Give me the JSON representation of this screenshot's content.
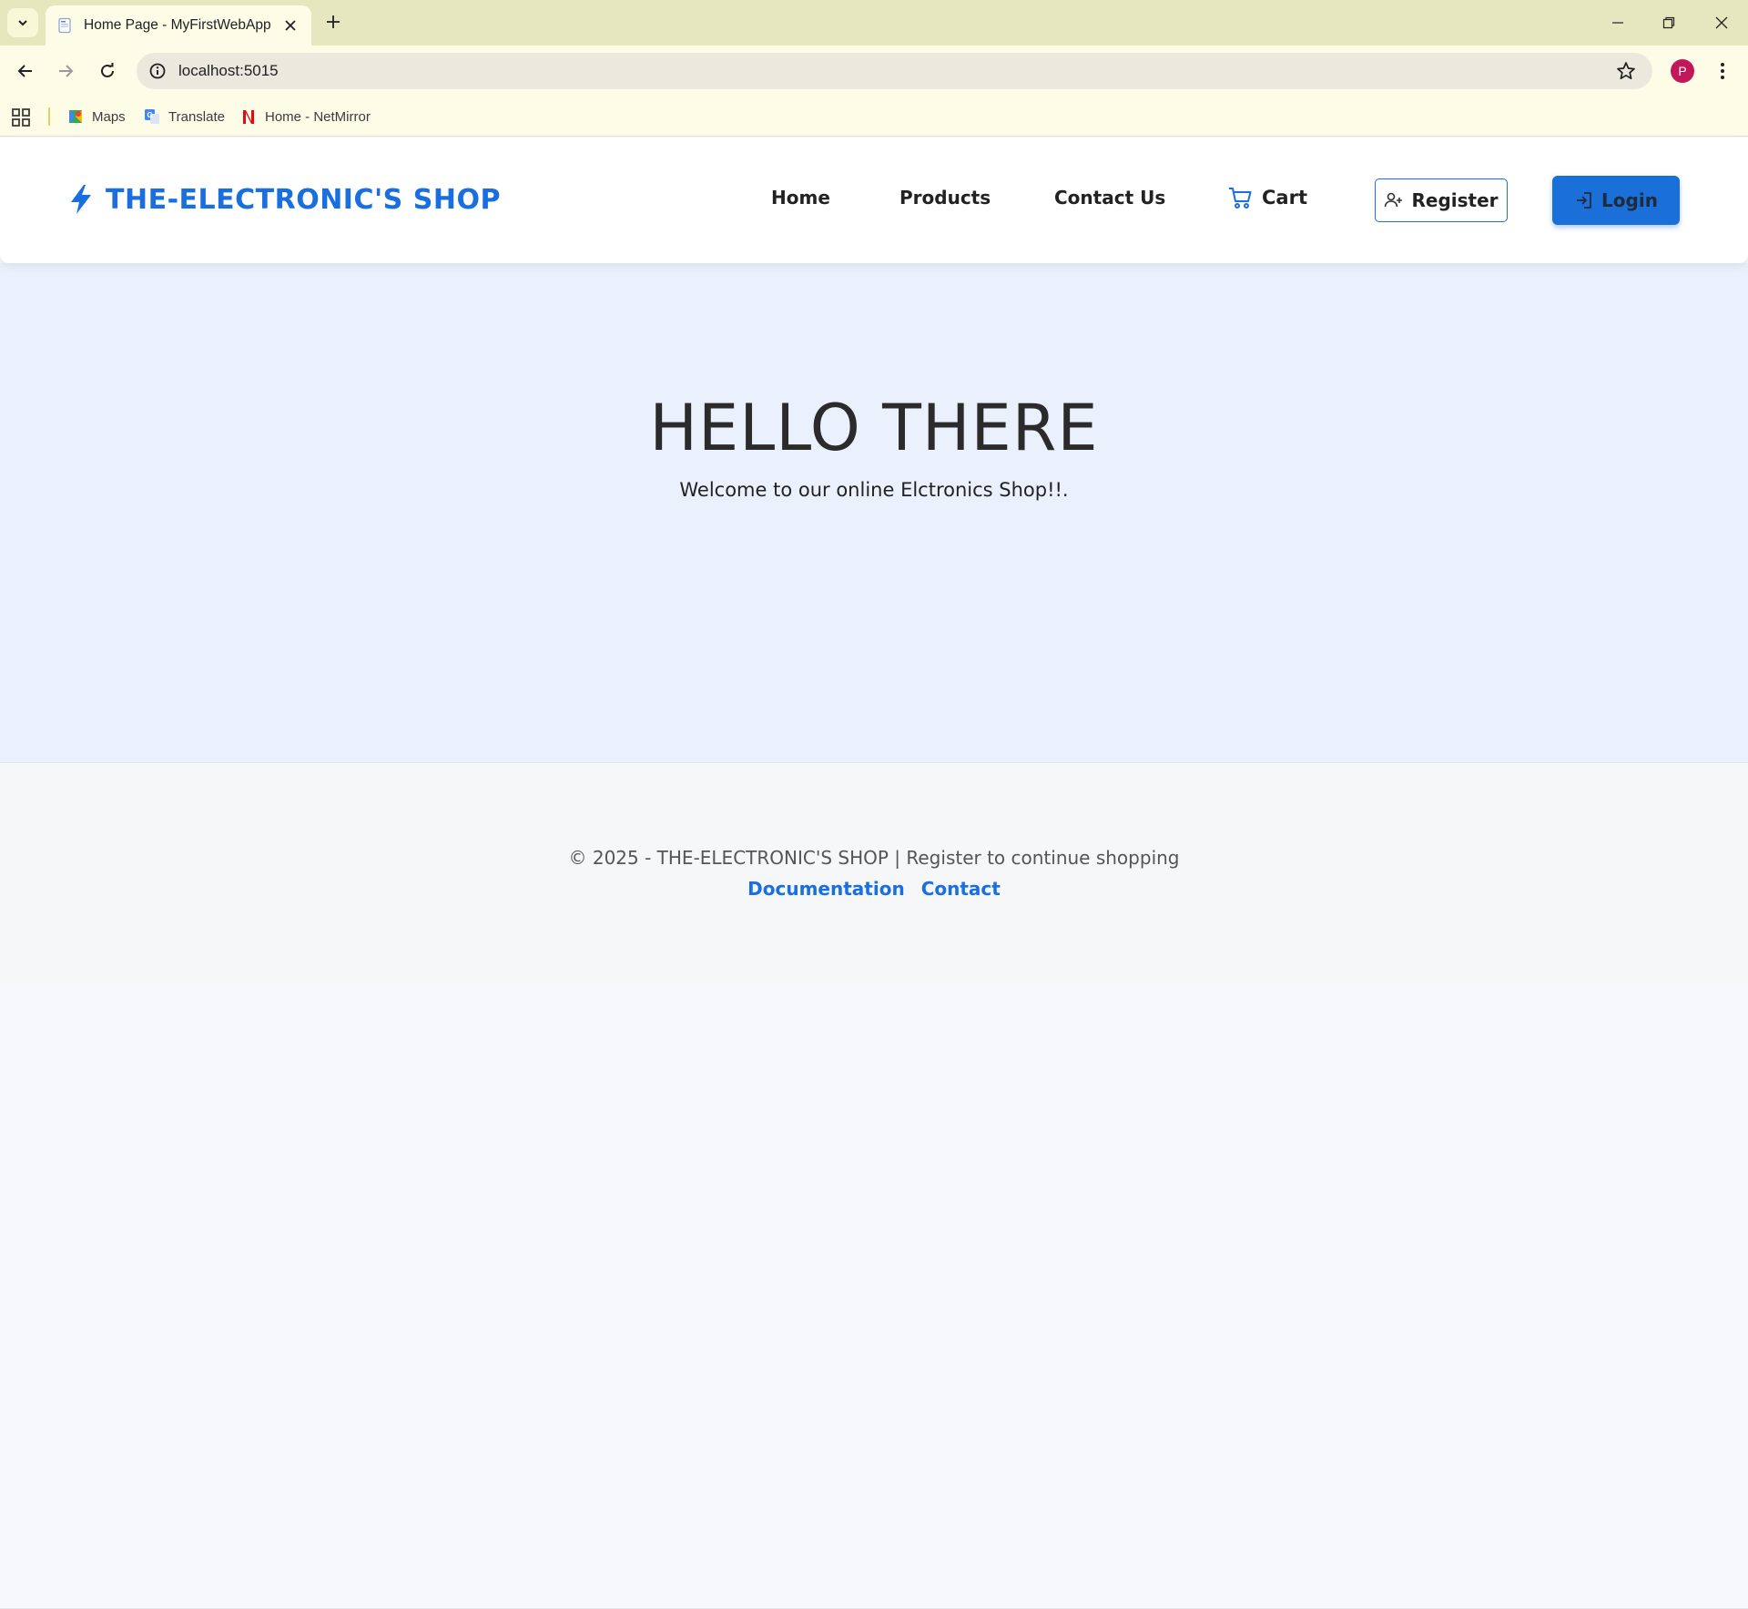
{
  "browser": {
    "tab_title": "Home Page - MyFirstWebApp",
    "url": "localhost:5015",
    "profile_initial": "P",
    "bookmarks": [
      {
        "label": "Maps",
        "icon": "maps-icon"
      },
      {
        "label": "Translate",
        "icon": "translate-icon"
      },
      {
        "label": "Home - NetMirror",
        "icon": "netmirror-icon"
      }
    ],
    "colors": {
      "chrome": "#e6e6bf",
      "toolbar": "#fcfce7",
      "omnibox": "#ebe9de",
      "profile": "#c2185b"
    }
  },
  "site": {
    "brand": "THE-ELECTRONIC'S SHOP",
    "nav": {
      "home": "Home",
      "products": "Products",
      "contact": "Contact Us",
      "cart": "Cart",
      "register": "Register",
      "login": "Login"
    },
    "hero": {
      "heading": "HELLO THERE",
      "subtitle": "Welcome to our online Elctronics Shop!!."
    },
    "footer": {
      "copyright": "© 2025 - THE-ELECTRONIC'S SHOP | Register to continue shopping",
      "links": [
        "Documentation",
        "Contact"
      ]
    },
    "colors": {
      "brand": "#1a6fe0",
      "hero_bg": "#eaf1fd",
      "login_bg": "#1a6fd8",
      "footer_bg": "#f6f7f9"
    }
  }
}
